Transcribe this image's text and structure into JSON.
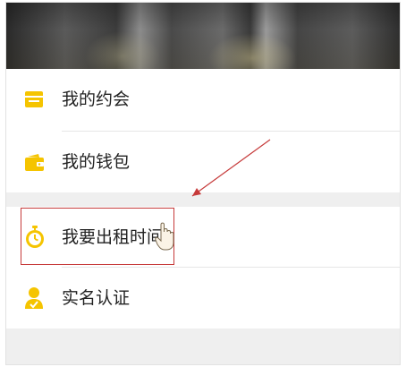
{
  "header": {
    "banner_image": "blurred photo banner"
  },
  "menu": {
    "items": [
      {
        "label": "我的约会",
        "icon": "calendar-card-icon"
      },
      {
        "label": "我的钱包",
        "icon": "wallet-icon"
      },
      {
        "label": "我要出租时间",
        "icon": "stopwatch-icon"
      },
      {
        "label": "实名认证",
        "icon": "user-verify-icon"
      }
    ]
  },
  "colors": {
    "accent": "#f5c400",
    "background": "#efefef",
    "annotation": "#c63a3a"
  }
}
